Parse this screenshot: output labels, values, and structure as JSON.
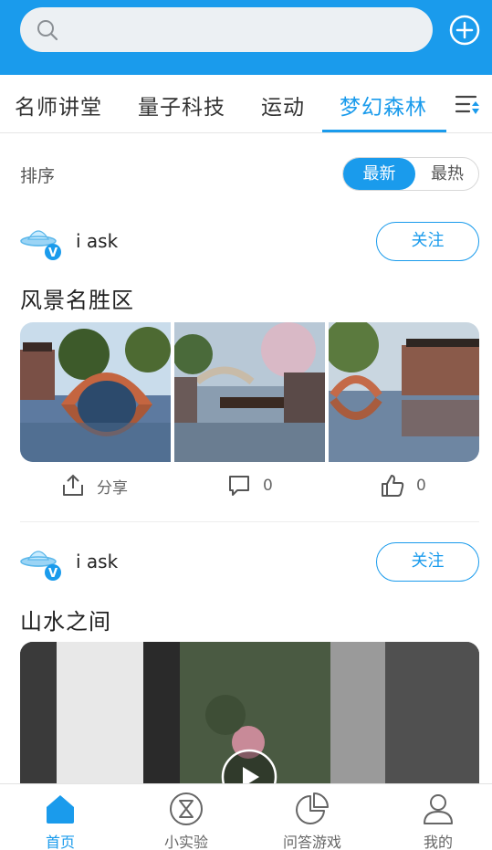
{
  "search": {
    "placeholder": ""
  },
  "tabs": [
    {
      "label": "名师讲堂"
    },
    {
      "label": "量子科技"
    },
    {
      "label": "运动"
    },
    {
      "label": "梦幻森林"
    }
  ],
  "active_tab": "梦幻森林",
  "sort": {
    "label": "排序",
    "options": [
      "最新",
      "最热"
    ],
    "selected": "最新"
  },
  "posts": [
    {
      "author": "i ask",
      "follow_label": "关注",
      "title": "风景名胜区",
      "actions": {
        "share": "分享",
        "comments": "0",
        "likes": "0"
      }
    },
    {
      "author": "i ask",
      "follow_label": "关注",
      "title": "山水之间"
    }
  ],
  "bottom_nav": [
    {
      "label": "首页"
    },
    {
      "label": "小实验"
    },
    {
      "label": "问答游戏"
    },
    {
      "label": "我的"
    }
  ],
  "active_nav": "首页",
  "colors": {
    "accent": "#1a9bec",
    "background": "#ffffff"
  }
}
